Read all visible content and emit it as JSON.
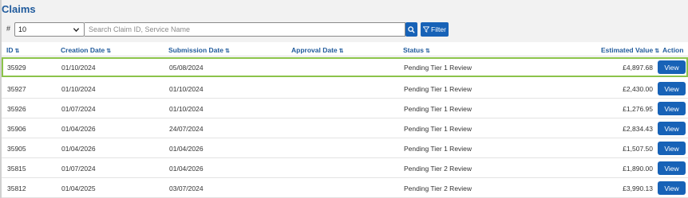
{
  "page": {
    "title": "Claims"
  },
  "toolbar": {
    "hash": "#",
    "page_size": "10",
    "search_placeholder": "Search Claim ID, Service Name",
    "filter_label": "Filter"
  },
  "table": {
    "columns": [
      "ID",
      "Creation Date",
      "Submission Date",
      "Approval Date",
      "Status",
      "Estimated Value",
      "Action"
    ],
    "rows": [
      {
        "id": "35929",
        "created": "01/10/2024",
        "submitted": "05/08/2024",
        "approved": "",
        "status": "Pending Tier 1 Review",
        "value": "£4,897.68",
        "action": "View"
      },
      {
        "id": "35927",
        "created": "01/10/2024",
        "submitted": "01/10/2024",
        "approved": "",
        "status": "Pending Tier 1 Review",
        "value": "£2,430.00",
        "action": "View"
      },
      {
        "id": "35926",
        "created": "01/07/2024",
        "submitted": "01/10/2024",
        "approved": "",
        "status": "Pending Tier 1 Review",
        "value": "£1,276.95",
        "action": "View"
      },
      {
        "id": "35906",
        "created": "01/04/2026",
        "submitted": "24/07/2024",
        "approved": "",
        "status": "Pending Tier 1 Review",
        "value": "£2,834.43",
        "action": "View"
      },
      {
        "id": "35905",
        "created": "01/04/2026",
        "submitted": "01/04/2026",
        "approved": "",
        "status": "Pending Tier 1 Review",
        "value": "£1,507.50",
        "action": "View"
      },
      {
        "id": "35815",
        "created": "01/07/2024",
        "submitted": "01/04/2026",
        "approved": "",
        "status": "Pending Tier 2 Review",
        "value": "£1,890.00",
        "action": "View"
      },
      {
        "id": "35812",
        "created": "01/04/2025",
        "submitted": "03/07/2024",
        "approved": "",
        "status": "Pending Tier 2 Review",
        "value": "£3,990.13",
        "action": "View"
      }
    ]
  },
  "colors": {
    "accent": "#1762b7",
    "title": "#1f5a9c",
    "selected_border": "#8bc34a"
  },
  "icons": {
    "search": "search-icon",
    "filter": "filter-icon",
    "sort": "sort-icon",
    "dropdown": "chevron-down-icon"
  }
}
